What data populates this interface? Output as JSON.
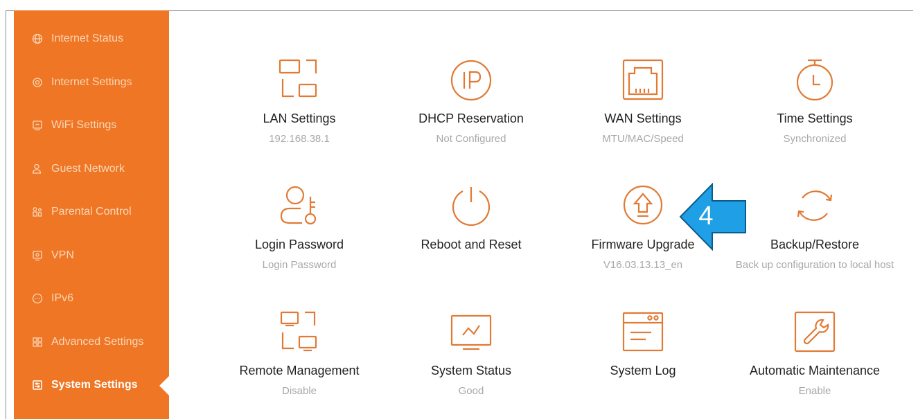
{
  "colors": {
    "brand": "#ee7624",
    "icon": "#e07a34",
    "callout": "#1e9fe6"
  },
  "sidebar": {
    "items": [
      {
        "label": "Internet Status",
        "icon": "globe-icon",
        "active": false
      },
      {
        "label": "Internet Settings",
        "icon": "internet-settings-icon",
        "active": false
      },
      {
        "label": "WiFi Settings",
        "icon": "wifi-settings-icon",
        "active": false
      },
      {
        "label": "Guest Network",
        "icon": "guest-network-icon",
        "active": false
      },
      {
        "label": "Parental Control",
        "icon": "parental-control-icon",
        "active": false
      },
      {
        "label": "VPN",
        "icon": "vpn-icon",
        "active": false
      },
      {
        "label": "IPv6",
        "icon": "ipv6-icon",
        "active": false
      },
      {
        "label": "Advanced Settings",
        "icon": "advanced-settings-icon",
        "active": false
      },
      {
        "label": "System Settings",
        "icon": "system-settings-icon",
        "active": true
      }
    ]
  },
  "tiles": [
    {
      "title": "LAN Settings",
      "subtitle": "192.168.38.1",
      "icon": "lan-icon"
    },
    {
      "title": "DHCP Reservation",
      "subtitle": "Not Configured",
      "icon": "ip-icon"
    },
    {
      "title": "WAN Settings",
      "subtitle": "MTU/MAC/Speed",
      "icon": "ethernet-port-icon"
    },
    {
      "title": "Time Settings",
      "subtitle": "Synchronized",
      "icon": "stopwatch-icon"
    },
    {
      "title": "Login Password",
      "subtitle": "Login Password",
      "icon": "user-key-icon"
    },
    {
      "title": "Reboot and Reset",
      "subtitle": "",
      "icon": "power-icon"
    },
    {
      "title": "Firmware Upgrade",
      "subtitle": "V16.03.13.13_en",
      "icon": "upload-arrow-icon"
    },
    {
      "title": "Backup/Restore",
      "subtitle": "Back up configuration to local host",
      "icon": "refresh-icon"
    },
    {
      "title": "Remote Management",
      "subtitle": "Disable",
      "icon": "remote-management-icon"
    },
    {
      "title": "System Status",
      "subtitle": "Good",
      "icon": "monitor-chart-icon"
    },
    {
      "title": "System Log",
      "subtitle": "",
      "icon": "log-window-icon"
    },
    {
      "title": "Automatic Maintenance",
      "subtitle": "Enable",
      "icon": "wrench-icon"
    }
  ],
  "callout": {
    "number": "4"
  }
}
